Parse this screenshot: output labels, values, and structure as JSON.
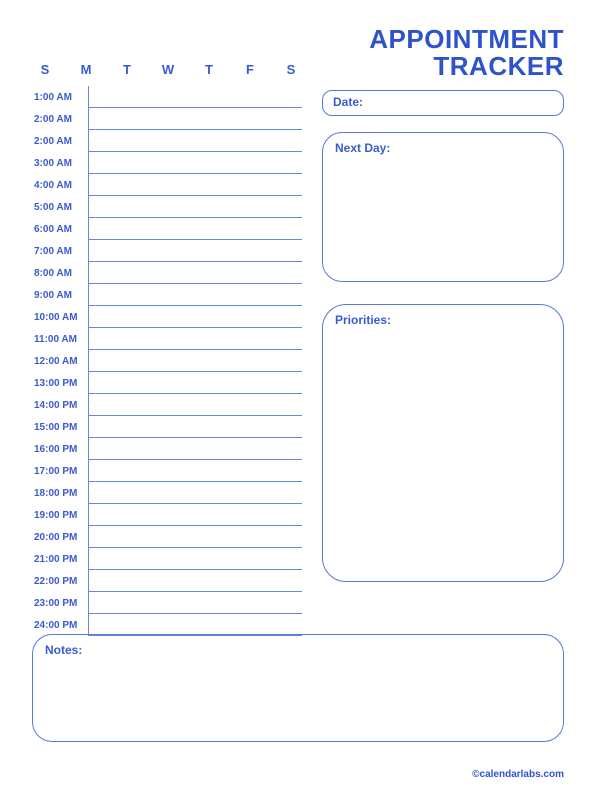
{
  "title_line1": "APPOINTMENT",
  "title_line2": "TRACKER",
  "days": [
    "S",
    "M",
    "T",
    "W",
    "T",
    "F",
    "S"
  ],
  "time_slots": [
    "1:00 AM",
    "2:00 AM",
    "2:00 AM",
    "3:00 AM",
    "4:00 AM",
    "5:00 AM",
    "6:00 AM",
    "7:00 AM",
    "8:00 AM",
    "9:00 AM",
    "10:00 AM",
    "11:00 AM",
    "12:00 AM",
    "13:00 PM",
    "14:00 PM",
    "15:00 PM",
    "16:00 PM",
    "17:00 PM",
    "18:00 PM",
    "19:00 PM",
    "20:00 PM",
    "21:00 PM",
    "22:00 PM",
    "23:00 PM",
    "24:00 PM"
  ],
  "labels": {
    "date": "Date:",
    "next_day": "Next Day:",
    "priorities": "Priorities:",
    "notes": "Notes:"
  },
  "footer": "©calendarlabs.com"
}
